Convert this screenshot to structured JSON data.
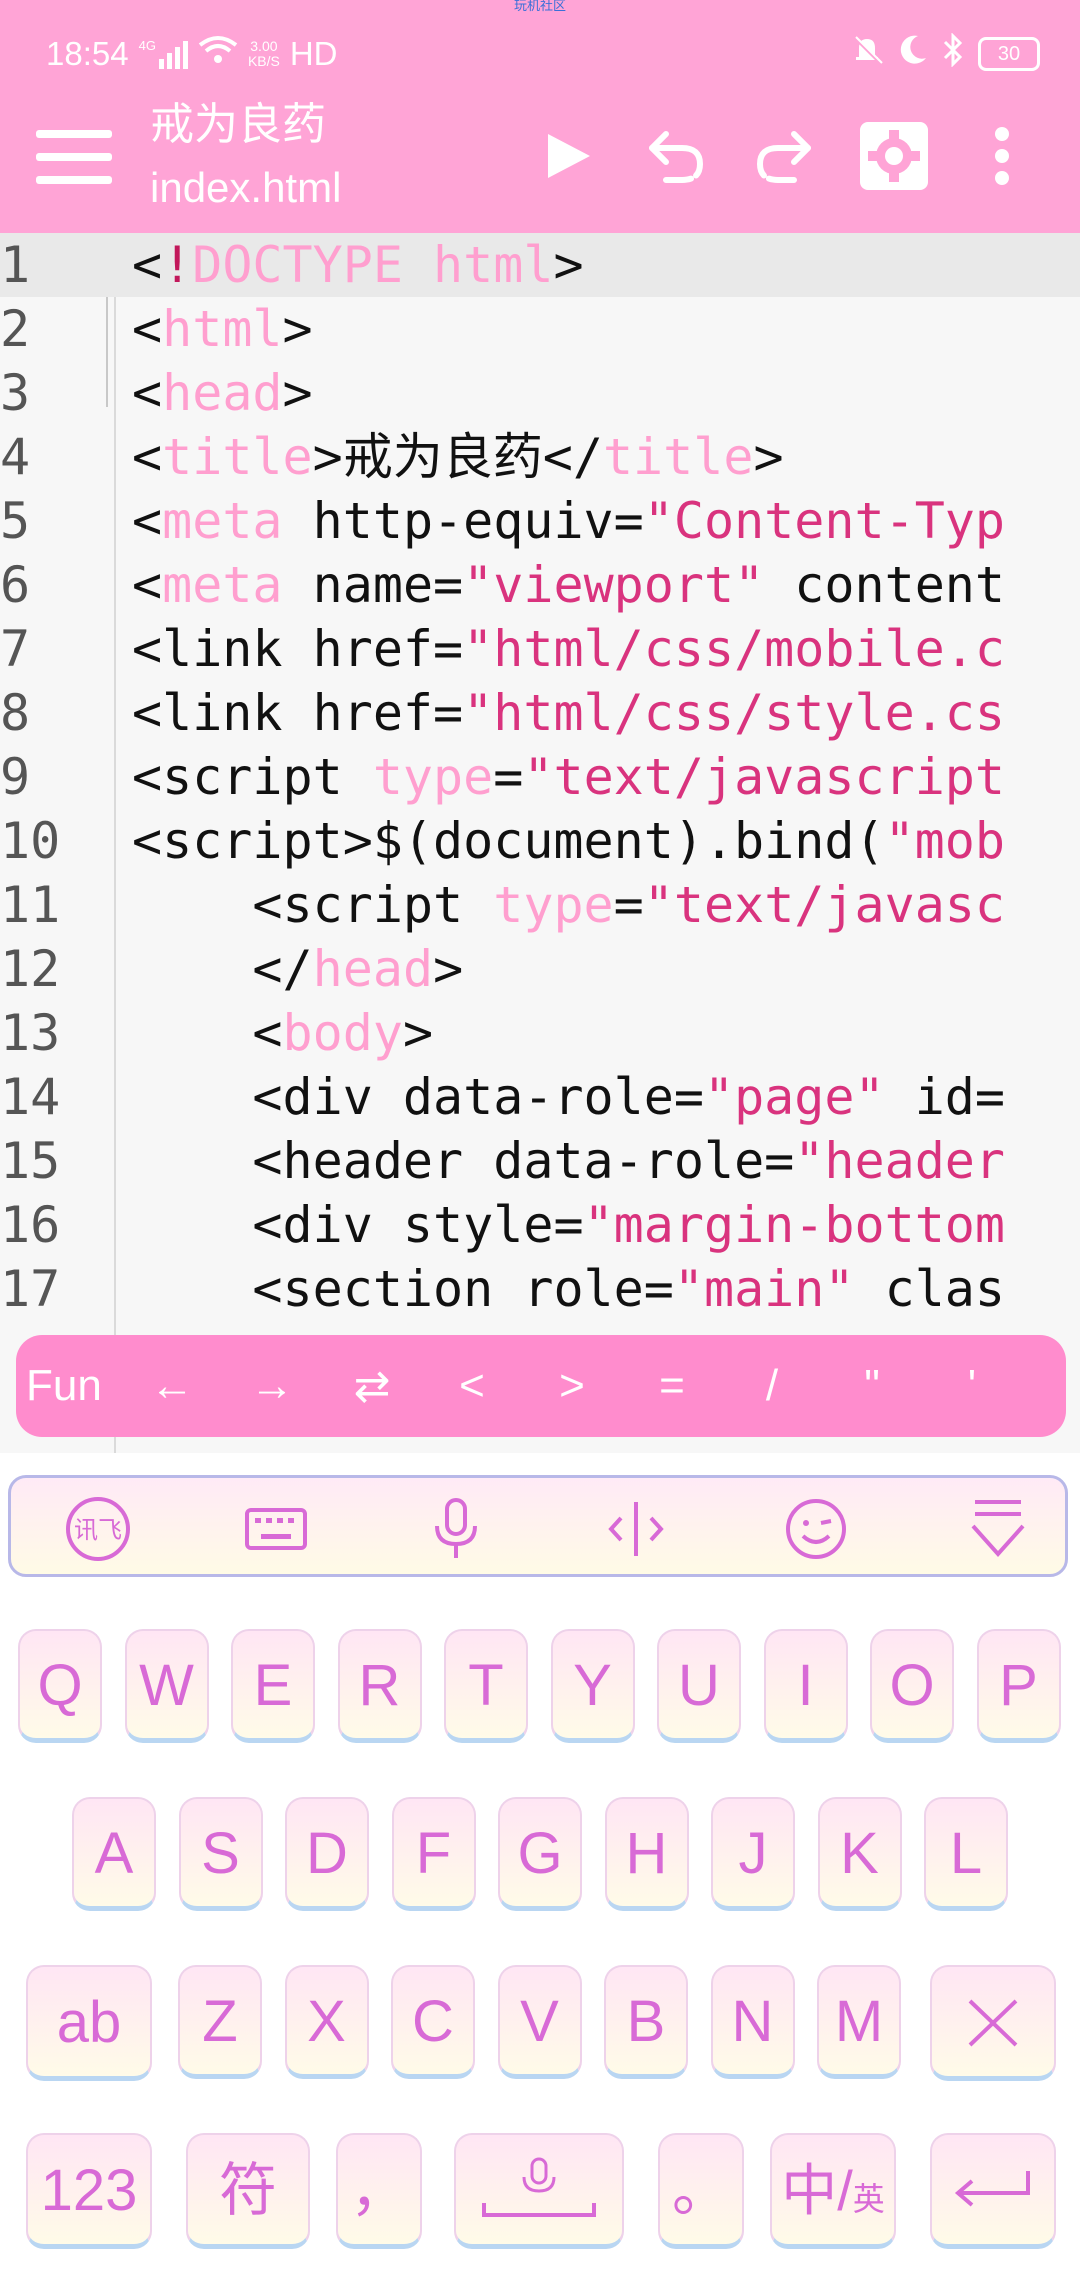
{
  "status_bar": {
    "watermark": "玩机社区",
    "time": "18:54",
    "network_type": "4G",
    "net_speed_value": "3.00",
    "net_speed_unit": "KB/S",
    "hd_label": "HD",
    "battery": "30"
  },
  "app_bar": {
    "title": "戒为良药",
    "filename": "index.html",
    "icons": [
      "menu-icon",
      "run-icon",
      "undo-icon",
      "redo-icon",
      "settings-icon",
      "more-icon"
    ]
  },
  "editor": {
    "lines": [
      {
        "n": "1",
        "indent": "",
        "parts": [
          [
            "<",
            "p"
          ],
          [
            "!",
            "bang"
          ],
          [
            "DOCTYPE html",
            "tag"
          ],
          [
            ">",
            "p"
          ]
        ]
      },
      {
        "n": "2",
        "indent": "",
        "parts": [
          [
            "<",
            "p"
          ],
          [
            "html",
            "tag"
          ],
          [
            ">",
            "p"
          ]
        ]
      },
      {
        "n": "3",
        "indent": "",
        "parts": [
          [
            "<",
            "p"
          ],
          [
            "head",
            "tag"
          ],
          [
            ">",
            "p"
          ]
        ]
      },
      {
        "n": "4",
        "indent": "",
        "parts": [
          [
            "<",
            "p"
          ],
          [
            "title",
            "tag"
          ],
          [
            ">",
            "p"
          ],
          [
            "戒为良药",
            "cjk"
          ],
          [
            "</",
            "p"
          ],
          [
            "title",
            "tag"
          ],
          [
            ">",
            "p"
          ]
        ]
      },
      {
        "n": "5",
        "indent": "",
        "parts": [
          [
            "<",
            "p"
          ],
          [
            "meta",
            "tag"
          ],
          [
            " http-equiv=",
            "p"
          ],
          [
            "\"Content-Typ",
            "str"
          ]
        ]
      },
      {
        "n": "6",
        "indent": "",
        "parts": [
          [
            "<",
            "p"
          ],
          [
            "meta",
            "tag"
          ],
          [
            " name=",
            "p"
          ],
          [
            "\"viewport\"",
            "str"
          ],
          [
            " content",
            "p"
          ]
        ]
      },
      {
        "n": "7",
        "indent": "",
        "parts": [
          [
            "<link href=",
            "p"
          ],
          [
            "\"html/css/mobile.c",
            "str"
          ]
        ]
      },
      {
        "n": "8",
        "indent": "",
        "parts": [
          [
            "<link href=",
            "p"
          ],
          [
            "\"html/css/style.cs",
            "str"
          ]
        ]
      },
      {
        "n": "9",
        "indent": "",
        "parts": [
          [
            "<script ",
            "p"
          ],
          [
            "type",
            "tag"
          ],
          [
            "=",
            "p"
          ],
          [
            "\"text/javascript",
            "str"
          ]
        ]
      },
      {
        "n": "10",
        "indent": "",
        "parts": [
          [
            "<script>$(document).bind(",
            "p"
          ],
          [
            "\"mob",
            "str"
          ]
        ]
      },
      {
        "n": "11",
        "indent": "    ",
        "parts": [
          [
            "<script ",
            "p"
          ],
          [
            "type",
            "tag"
          ],
          [
            "=",
            "p"
          ],
          [
            "\"text/javasc",
            "str"
          ]
        ]
      },
      {
        "n": "12",
        "indent": "    ",
        "parts": [
          [
            "</",
            "p"
          ],
          [
            "head",
            "tag"
          ],
          [
            ">",
            "p"
          ]
        ]
      },
      {
        "n": "13",
        "indent": "    ",
        "parts": [
          [
            "<",
            "p"
          ],
          [
            "body",
            "tag"
          ],
          [
            ">",
            "p"
          ]
        ]
      },
      {
        "n": "14",
        "indent": "    ",
        "parts": [
          [
            "<div data-role=",
            "p"
          ],
          [
            "\"page\"",
            "str"
          ],
          [
            " id=",
            "p"
          ]
        ]
      },
      {
        "n": "15",
        "indent": "    ",
        "parts": [
          [
            "<header data-role=",
            "p"
          ],
          [
            "\"header",
            "str"
          ]
        ]
      },
      {
        "n": "16",
        "indent": "    ",
        "parts": [
          [
            "<div style=",
            "p"
          ],
          [
            "\"margin-bottom",
            "str"
          ]
        ]
      },
      {
        "n": "17",
        "indent": "    ",
        "parts": [
          [
            "<section role=",
            "p"
          ],
          [
            "\"main\"",
            "str"
          ],
          [
            " clas",
            "p"
          ]
        ]
      }
    ]
  },
  "function_bar": {
    "keys": [
      "Fun",
      "←",
      "→",
      "⇄",
      "<",
      ">",
      "=",
      "/",
      "\"",
      "'"
    ]
  },
  "keyboard": {
    "toolbar": [
      "ifly-logo-icon",
      "keyboard-icon",
      "microphone-icon",
      "cursor-move-icon",
      "emoji-icon",
      "collapse-keyboard-icon"
    ],
    "rows": [
      [
        "Q",
        "W",
        "E",
        "R",
        "T",
        "Y",
        "U",
        "I",
        "O",
        "P"
      ],
      [
        "A",
        "S",
        "D",
        "F",
        "G",
        "H",
        "J",
        "K",
        "L"
      ],
      [
        "Z",
        "X",
        "C",
        "V",
        "B",
        "N",
        "M"
      ]
    ],
    "shift_label": "ab",
    "numbers_label": "123",
    "symbols_label": "符",
    "comma_label": "，",
    "period_label": "。",
    "lang_label_main": "中/",
    "lang_label_sub": "英"
  },
  "colors": {
    "brand_pink": "#ffa4d6",
    "fun_bar_pink": "#ff8ccd",
    "key_text": "#d86ad6",
    "string_color": "#d9337e",
    "tag_color": "#ff9fcf"
  }
}
